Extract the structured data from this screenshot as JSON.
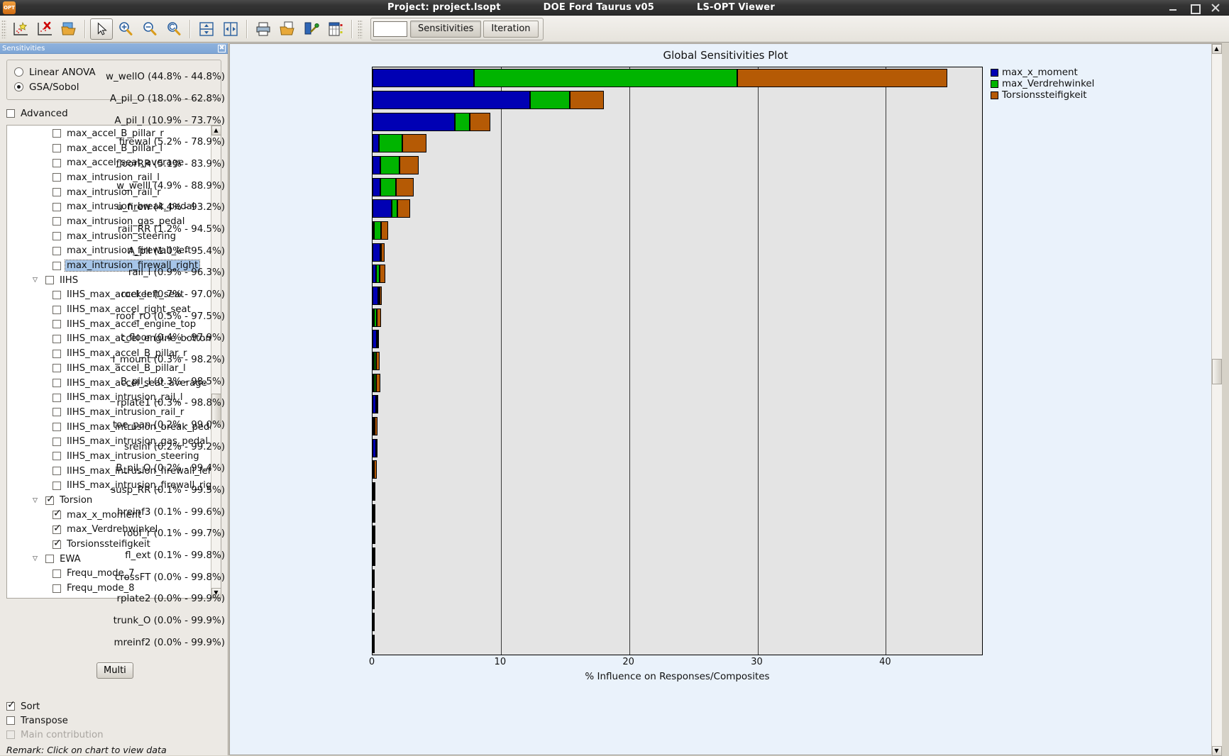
{
  "window": {
    "project": "Project: project.lsopt",
    "doc": "DOE Ford Taurus v05",
    "app": "LS-OPT Viewer",
    "minimize": "–",
    "maximize": "□",
    "close": "✕",
    "app_icon": "OPT"
  },
  "toolbar": {
    "buttons": [
      {
        "name": "new-plot-icon",
        "glyph": "★"
      },
      {
        "name": "delete-plot-icon",
        "glyph": "✖"
      },
      {
        "name": "open-folder-icon",
        "glyph": "📂"
      },
      {
        "name": "pointer-icon",
        "glyph": "↖"
      },
      {
        "name": "zoom-in-icon",
        "glyph": "🔍"
      },
      {
        "name": "zoom-out-icon",
        "glyph": "🔍"
      },
      {
        "name": "zoom-reset-icon",
        "glyph": "🔍"
      },
      {
        "name": "split-horizontal-icon",
        "glyph": "⇕"
      },
      {
        "name": "split-vertical-icon",
        "glyph": "⇔"
      },
      {
        "name": "print-icon",
        "glyph": "🖨"
      },
      {
        "name": "save-image-icon",
        "glyph": "📄"
      },
      {
        "name": "settings-plot-icon",
        "glyph": "🔧"
      },
      {
        "name": "table-view-icon",
        "glyph": "▥"
      }
    ],
    "mode_color_label": "",
    "tabs": [
      {
        "label": "Sensitivities",
        "active": true
      },
      {
        "label": "Iteration",
        "active": false
      }
    ]
  },
  "sidebar": {
    "title": "Sensitivities",
    "close_glyph": "✖",
    "method_options": [
      {
        "label": "Linear ANOVA",
        "selected": false
      },
      {
        "label": "GSA/Sobol",
        "selected": true
      }
    ],
    "advanced": {
      "label": "Advanced",
      "checked": false
    },
    "tree": [
      {
        "label": "max_accel_B_pillar_r",
        "level": 1,
        "checked": false,
        "selected": false
      },
      {
        "label": "max_accel_B_pillar_l",
        "level": 1,
        "checked": false,
        "selected": false
      },
      {
        "label": "max_accel_seat_average",
        "level": 1,
        "checked": false,
        "selected": false
      },
      {
        "label": "max_intrusion_rail_l",
        "level": 1,
        "checked": false,
        "selected": false
      },
      {
        "label": "max_intrusion_rail_r",
        "level": 1,
        "checked": false,
        "selected": false
      },
      {
        "label": "max_intrusion_break_pedal",
        "level": 1,
        "checked": false,
        "selected": false
      },
      {
        "label": "max_intrusion_gas_pedal",
        "level": 1,
        "checked": false,
        "selected": false
      },
      {
        "label": "max_intrusion_steering",
        "level": 1,
        "checked": false,
        "selected": false
      },
      {
        "label": "max_intrusion_firewall_left",
        "level": 1,
        "checked": false,
        "selected": false
      },
      {
        "label": "max_intrusion_firewall_right",
        "level": 1,
        "checked": false,
        "selected": true
      },
      {
        "label": "IIHS",
        "level": 0,
        "checked": false,
        "selected": false,
        "group": true,
        "expanded": true
      },
      {
        "label": "IIHS_max_accel_left_seat",
        "level": 1,
        "checked": false,
        "selected": false
      },
      {
        "label": "IIHS_max_accel_right_seat",
        "level": 1,
        "checked": false,
        "selected": false
      },
      {
        "label": "IIHS_max_accel_engine_top",
        "level": 1,
        "checked": false,
        "selected": false
      },
      {
        "label": "IIHS_max_accel_engine_bottom",
        "level": 1,
        "checked": false,
        "selected": false
      },
      {
        "label": "IIHS_max_accel_B_pillar_r",
        "level": 1,
        "checked": false,
        "selected": false
      },
      {
        "label": "IIHS_max_accel_B_pillar_l",
        "level": 1,
        "checked": false,
        "selected": false
      },
      {
        "label": "IIHS_max_accel_seat_average",
        "level": 1,
        "checked": false,
        "selected": false
      },
      {
        "label": "IIHS_max_intrusion_rail_l",
        "level": 1,
        "checked": false,
        "selected": false
      },
      {
        "label": "IIHS_max_intrusion_rail_r",
        "level": 1,
        "checked": false,
        "selected": false
      },
      {
        "label": "IIHS_max_intrusion_break_pedal",
        "level": 1,
        "checked": false,
        "selected": false
      },
      {
        "label": "IIHS_max_intrusion_gas_pedal",
        "level": 1,
        "checked": false,
        "selected": false
      },
      {
        "label": "IIHS_max_intrusion_steering",
        "level": 1,
        "checked": false,
        "selected": false
      },
      {
        "label": "IIHS_max_intrusion_firewall_left",
        "level": 1,
        "checked": false,
        "selected": false
      },
      {
        "label": "IIHS_max_intrusion_firewall_right",
        "level": 1,
        "checked": false,
        "selected": false
      },
      {
        "label": "Torsion",
        "level": 0,
        "checked": true,
        "selected": false,
        "group": true,
        "expanded": true
      },
      {
        "label": "max_x_moment",
        "level": 1,
        "checked": true,
        "selected": false
      },
      {
        "label": "max_Verdrehwinkel",
        "level": 1,
        "checked": true,
        "selected": false
      },
      {
        "label": "Torsionssteifigkeit",
        "level": 1,
        "checked": true,
        "selected": false
      },
      {
        "label": "EWA",
        "level": 0,
        "checked": false,
        "selected": false,
        "group": true,
        "expanded": true
      },
      {
        "label": "Frequ_mode_7",
        "level": 1,
        "checked": false,
        "selected": false
      },
      {
        "label": "Frequ_mode_8",
        "level": 1,
        "checked": false,
        "selected": false
      }
    ],
    "bottom": {
      "sort": {
        "label": "Sort",
        "checked": true
      },
      "transpose": {
        "label": "Transpose",
        "checked": false
      },
      "main_contribution": {
        "label": "Main contribution",
        "checked": false,
        "disabled": true
      },
      "multi_button": "Multi",
      "remark": "Remark: Click on chart to view data"
    }
  },
  "chart_data": {
    "type": "bar",
    "orientation": "horizontal",
    "stacked": true,
    "title": "Global Sensitivities Plot",
    "xlabel": "% Influence on Responses/Composites",
    "ylabel": "",
    "xlim": [
      0,
      47.5
    ],
    "xticks": [
      0,
      10,
      20,
      30,
      40
    ],
    "grid": true,
    "legend_position": "right",
    "legend": [
      {
        "name": "max_x_moment",
        "color": "#0000b4"
      },
      {
        "name": "max_Verdrehwinkel",
        "color": "#00b400"
      },
      {
        "name": "Torsionssteifigkeit",
        "color": "#b55a05"
      }
    ],
    "categories": [
      "w_wellO (44.8% - 44.8%)",
      "A_pil_O (18.0% - 62.8%)",
      "A_pil_I (10.9% - 73.7%)",
      "firewal (5.2% - 78.9%)",
      "floorRR (5.1% - 83.9%)",
      "w_wellI (4.9% - 88.9%)",
      "u_firew (4.4% - 93.2%)",
      "rail_RR (1.2% - 94.5%)",
      "A_pil (1.0% - 95.4%)",
      "rail_l (0.9% - 96.3%)",
      "rocker (0.7% - 97.0%)",
      "roof_rO (0.5% - 97.5%)",
      "t_floor (0.4% - 97.9%)",
      "l_mount (0.3% - 98.2%)",
      "B_pil_I (0.3% - 98.5%)",
      "rplate1 (0.3% - 98.8%)",
      "toe_pan (0.2% - 99.0%)",
      "sreinf (0.2% - 99.2%)",
      "B_pil_O (0.2% - 99.4%)",
      "susp_RR (0.1% - 99.5%)",
      "hreinf3 (0.1% - 99.6%)",
      "roof_r (0.1% - 99.7%)",
      "fl_ext (0.1% - 99.8%)",
      "crossFT (0.0% - 99.8%)",
      "rplate2 (0.0% - 99.9%)",
      "trunk_O (0.0% - 99.9%)",
      "mreinf2 (0.0% - 99.9%)"
    ],
    "series": [
      {
        "name": "max_x_moment",
        "color": "#0000b4",
        "values": [
          7.9,
          12.3,
          6.4,
          0.5,
          0.6,
          0.6,
          1.5,
          0.1,
          0.6,
          0.25,
          0.45,
          0.1,
          0.35,
          0.1,
          0.1,
          0.3,
          0.05,
          0.25,
          0.02,
          0.05,
          0.1,
          0.02,
          0.05,
          0.05,
          0.05,
          0.05,
          0.05
        ]
      },
      {
        "name": "max_Verdrehwinkel",
        "color": "#00b400",
        "values": [
          20.5,
          3.1,
          1.2,
          1.8,
          1.5,
          1.2,
          0.45,
          0.55,
          0.08,
          0.3,
          0.1,
          0.25,
          0.05,
          0.18,
          0.2,
          0.05,
          0.1,
          0.02,
          0.08,
          0.08,
          0.02,
          0.08,
          0.05,
          0.03,
          0.03,
          0.03,
          0.03
        ]
      },
      {
        "name": "Torsionssteifigkeit",
        "color": "#b55a05",
        "values": [
          16.4,
          2.6,
          1.6,
          1.9,
          1.5,
          1.4,
          1.0,
          0.55,
          0.25,
          0.45,
          0.18,
          0.3,
          0.08,
          0.25,
          0.3,
          0.08,
          0.22,
          0.08,
          0.22,
          0.1,
          0.06,
          0.1,
          0.08,
          0.05,
          0.05,
          0.05,
          0.05
        ]
      }
    ]
  }
}
